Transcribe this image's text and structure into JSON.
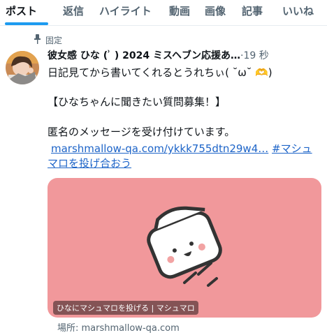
{
  "tabs": [
    "ポスト",
    "返信",
    "ハイライト",
    "動画",
    "画像",
    "記事",
    "いいね"
  ],
  "active_tab": "ポスト",
  "pinned_label": "固定",
  "post": {
    "display_name": "彼女感 ひな ( ͗ ) 2024 ミスヘブン応援あ…",
    "time": "·19 秒",
    "line1": "日記見てから書いてくれるとうれちぃ( ˘ω˘ 🫶)",
    "line2": "【ひなちゃんに聞きたい質問募集！】",
    "line3": "匿名のメッセージを受け付けています。",
    "link_text": "marshmallow-qa.com/ykkk755dtn29w4…",
    "hashtag_part1": "#マシュ",
    "hashtag_part2": "マロを投げ合おう"
  },
  "card": {
    "caption": "ひなにマシュマロを投げる | マシュマロ",
    "domain": "場所: marshmallow-qa.com",
    "background": "#f1989b"
  },
  "colors": {
    "accent": "#1d9bf0",
    "link": "#1d64c8",
    "muted": "#536471"
  },
  "icons": {
    "pin": "pin-icon",
    "card_illustration": "marshmallow-icon"
  }
}
